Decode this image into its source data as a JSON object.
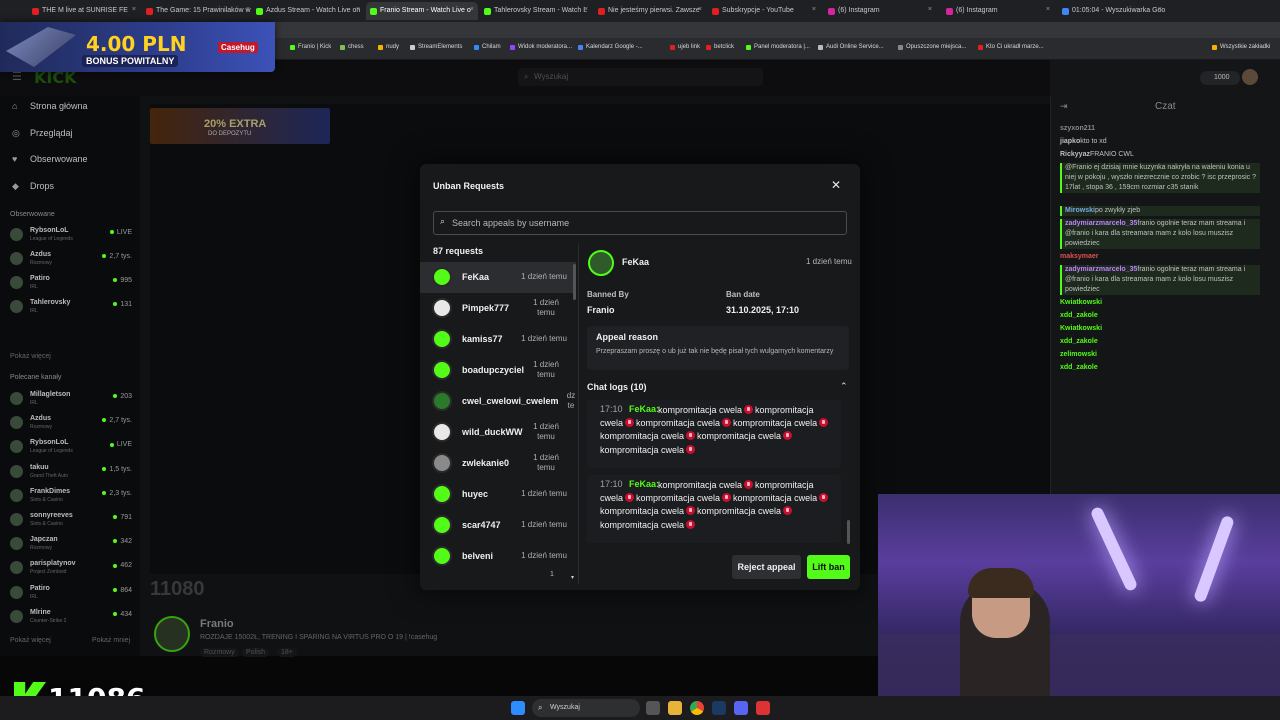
{
  "browser": {
    "tabs": [
      {
        "label": "THE M live at SUNRISE FE",
        "color": "#e02020"
      },
      {
        "label": "The Game: 15 Prawinilaków w",
        "color": "#e02020"
      },
      {
        "label": "Azdus Stream - Watch Live on",
        "color": "#53fc18"
      },
      {
        "label": "Franio Stream - Watch Live o",
        "color": "#53fc18"
      },
      {
        "label": "Tahlerovsky Stream - Watch L",
        "color": "#53fc18"
      },
      {
        "label": "Nie jesteśmy pierwsi. Zawsze",
        "color": "#e02020"
      },
      {
        "label": "Subskrypcje - YouTube",
        "color": "#e02020"
      },
      {
        "label": "(6) Instagram",
        "color": "#d6249f"
      },
      {
        "label": "(6) Instagram",
        "color": "#d6249f"
      },
      {
        "label": "01:05:04 - Wyszukiwarka Goo",
        "color": "#4285f4"
      }
    ],
    "bookmarks": [
      {
        "label": "Franio | Kick",
        "color": "#53fc18"
      },
      {
        "label": "chess",
        "color": "#7cbf5a"
      },
      {
        "label": "nudy",
        "color": "#f4b400"
      },
      {
        "label": "StreamElements",
        "color": "#cccccc"
      },
      {
        "label": "Chilam",
        "color": "#2d8cff"
      },
      {
        "label": "Widok moderatora...",
        "color": "#9146ff"
      },
      {
        "label": "Kalendarz Google -...",
        "color": "#4285f4"
      },
      {
        "label": "ujeb link",
        "color": "#e02020"
      },
      {
        "label": "betclick",
        "color": "#e02020"
      },
      {
        "label": "Panel moderatora |...",
        "color": "#53fc18"
      },
      {
        "label": "Audi Online Service...",
        "color": "#bbbbbb"
      },
      {
        "label": "Opuszczone miejsca...",
        "color": "#888888"
      },
      {
        "label": "Kto Ci ukradł marze...",
        "color": "#e02020"
      },
      {
        "label": "Wszystkie zakładki",
        "color": "#f4b400"
      }
    ]
  },
  "promo": {
    "amount": "4.00 PLN",
    "caption": "BONUS POWITALNY",
    "brand": "Casehug"
  },
  "promo2": {
    "percent": "20% EXTRA",
    "caption": "DO DEPOZYTU"
  },
  "site": {
    "search_placeholder": "Wyszukaj",
    "kicks": "1000",
    "nav": [
      {
        "label": "Strona główna",
        "icon": "home-icon",
        "glyph": "⌂"
      },
      {
        "label": "Przeglądaj",
        "icon": "compass-icon",
        "glyph": "◎"
      },
      {
        "label": "Obserwowane",
        "icon": "heart-icon",
        "glyph": "♥"
      },
      {
        "label": "Drops",
        "icon": "drops-icon",
        "glyph": "◆"
      }
    ],
    "followed_heading": "Obserwowane",
    "followed": [
      {
        "name": "RybsonLoL",
        "game": "League of Legends",
        "viewers": "LIVE"
      },
      {
        "name": "Azdus",
        "game": "Rozmowy",
        "viewers": "2,7 tys."
      },
      {
        "name": "Patiro",
        "game": "IRL",
        "viewers": "995"
      },
      {
        "name": "Tahlerovsky",
        "game": "IRL",
        "viewers": "131"
      }
    ],
    "show_more": "Pokaż więcej",
    "recommended_heading": "Polecane kanały",
    "recommended": [
      {
        "name": "Millagletson",
        "game": "IRL",
        "viewers": "203"
      },
      {
        "name": "Azdus",
        "game": "Rozmowy",
        "viewers": "2,7 tys."
      },
      {
        "name": "RybsonLoL",
        "game": "League of Legends",
        "viewers": "LIVE"
      },
      {
        "name": "takuu",
        "game": "Grand Theft Auto",
        "viewers": "1,5 tys."
      },
      {
        "name": "FrankDimes",
        "game": "Slots & Casino",
        "viewers": "2,3 tys."
      },
      {
        "name": "sonnyreeves",
        "game": "Slots & Casino",
        "viewers": "791"
      },
      {
        "name": "Japczan",
        "game": "Rozmowy",
        "viewers": "342"
      },
      {
        "name": "parisplatynov",
        "game": "Project Zomboid",
        "viewers": "462"
      },
      {
        "name": "Patiro",
        "game": "IRL",
        "viewers": "864"
      },
      {
        "name": "Mlrine",
        "game": "Counter-Strike 2",
        "viewers": "434"
      }
    ],
    "show_less": "Pokaż mniej",
    "streamer": {
      "name": "Franio",
      "title": "ROZDAJE 15002Ł, TRENING I SPARING NA VIRTUS PRO O 19 | !casehug",
      "tags": [
        "Rozmowy",
        "Polish",
        "18+"
      ],
      "viewers_big": "11080"
    },
    "viewers_overlay": "11086"
  },
  "chat": {
    "title": "Czat",
    "messages": [
      {
        "user": "szyxon211",
        "text": "",
        "color": "#888888",
        "hl": false
      },
      {
        "user": "jiapko",
        "text": "kto to xd",
        "color": "#bfbfbf",
        "hl": false
      },
      {
        "user": "Rickyyaz",
        "text": "FRANIO CWL",
        "color": "#bfbfbf",
        "hl": false
      },
      {
        "user": "",
        "text": "@Franio ej dzisiaj mnie kuzynka nakryła na waleniu konia u niej w pokoju , wyszło niezrecznie co zrobic ? isc przeprosic ? 17lat , stopa 36 , 159cm rozmiar c35 stanik",
        "color": "#e05050",
        "hl": true
      },
      {
        "user": "Mirowski",
        "text": "po zwykły zjeb",
        "color": "#7ad",
        "hl": true
      },
      {
        "user": "zadymiarzmarcelo_35",
        "text": "franio ogolnie teraz mam streama i @franio i kara dla streamara mam z kolo losu muszisz powiedziec",
        "color": "#c080ff",
        "hl": true
      },
      {
        "user": "maksymaer",
        "text": "",
        "color": "#e05050",
        "hl": false
      },
      {
        "user": "zadymiarzmarcelo_35",
        "text": "franio ogolnie teraz mam streama i @franio i kara dla streamara mam z kolo losu muszisz powiedziec",
        "color": "#c080ff",
        "hl": true
      },
      {
        "user": "Kwiatkowski",
        "text": "",
        "color": "#53fc18",
        "hl": false
      },
      {
        "user": "xdd_zakole",
        "text": "",
        "color": "#53fc18",
        "hl": false
      },
      {
        "user": "Kwiatkowski",
        "text": "",
        "color": "#53fc18",
        "hl": false
      },
      {
        "user": "xdd_zakole",
        "text": "",
        "color": "#53fc18",
        "hl": false
      },
      {
        "user": "zelimowski",
        "text": "",
        "color": "#53fc18",
        "hl": false
      },
      {
        "user": "xdd_zakole",
        "text": "",
        "color": "#53fc18",
        "hl": false
      }
    ]
  },
  "modal": {
    "title": "Unban Requests",
    "search_placeholder": "Search appeals by username",
    "count_label": "87 requests",
    "requests": [
      {
        "user": "FeKaa",
        "time": "1 dzień temu",
        "selected": true,
        "color": "#53fc18"
      },
      {
        "user": "Pimpek777",
        "time": "1 dzień temu",
        "selected": false,
        "color": "#e8e8e8"
      },
      {
        "user": "kamiss77",
        "time": "1 dzień temu",
        "selected": false,
        "color": "#53fc18"
      },
      {
        "user": "boadupczyciel",
        "time": "1 dzień temu",
        "selected": false,
        "color": "#53fc18"
      },
      {
        "user": "cwel_cwelowi_cwelem",
        "time": "dz te",
        "selected": false,
        "color": "#2a7a2a"
      },
      {
        "user": "wild_duckWW",
        "time": "1 dzień temu",
        "selected": false,
        "color": "#e8e8e8"
      },
      {
        "user": "zwlekanie0",
        "time": "1 dzień temu",
        "selected": false,
        "color": "#8a8a8a"
      },
      {
        "user": "huyec",
        "time": "1 dzień temu",
        "selected": false,
        "color": "#53fc18"
      },
      {
        "user": "scar4747",
        "time": "1 dzień temu",
        "selected": false,
        "color": "#53fc18"
      },
      {
        "user": "belveni",
        "time": "1 dzień temu",
        "selected": false,
        "color": "#53fc18"
      }
    ],
    "list_overflow": "1",
    "detail": {
      "user": "FeKaa",
      "time": "1 dzień temu",
      "banned_by_label": "Banned By",
      "banned_by": "Franio",
      "ban_date_label": "Ban date",
      "ban_date": "31.10.2025, 17:10",
      "reason_label": "Appeal reason",
      "reason": "Przepraszam proszę o ub już tak nie będę pisał tych wulgarnych komentarzy",
      "logs_label": "Chat logs (10)",
      "logs": [
        {
          "time": "17:10",
          "user": "FeKaa:",
          "word": "kompromitacja cwela",
          "repeat": 7
        },
        {
          "time": "17:10",
          "user": "FeKaa:",
          "word": "kompromitacja cwela",
          "repeat": 7
        }
      ]
    },
    "reject_label": "Reject appeal",
    "lift_label": "Lift ban"
  },
  "taskbar": {
    "search": "Wyszukaj"
  }
}
